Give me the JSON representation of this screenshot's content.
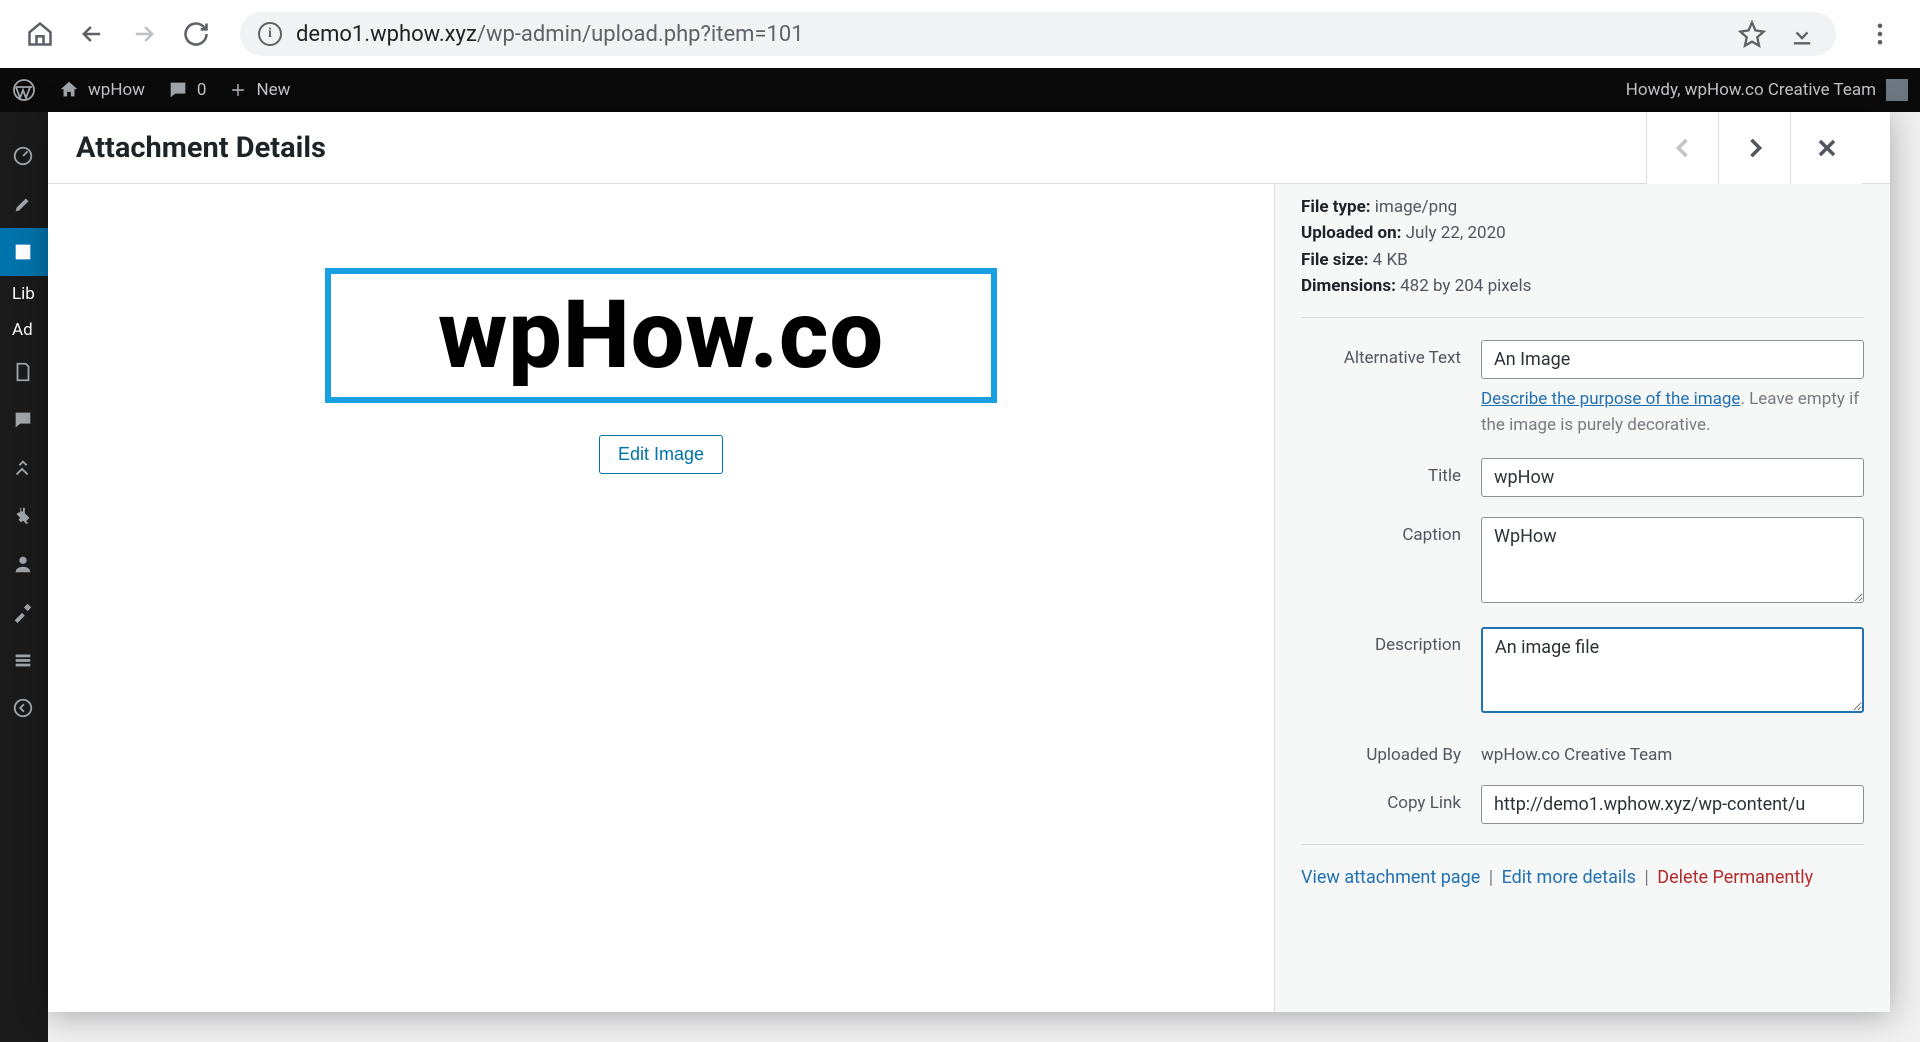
{
  "browser": {
    "url_domain": "demo1.wphow.xyz",
    "url_path": "/wp-admin/upload.php?item=101"
  },
  "adminbar": {
    "site_name": "wpHow",
    "comment_count": "0",
    "new_label": "New",
    "howdy": "Howdy, wpHow.co Creative Team"
  },
  "sidebar": {
    "lib_label": "Lib",
    "add_label": "Ad"
  },
  "modal": {
    "title": "Attachment Details",
    "meta": {
      "file_type_label": "File type:",
      "file_type_value": "image/png",
      "uploaded_on_label": "Uploaded on:",
      "uploaded_on_value": "July 22, 2020",
      "file_size_label": "File size:",
      "file_size_value": "4 KB",
      "dimensions_label": "Dimensions:",
      "dimensions_value": "482 by 204 pixels"
    },
    "preview_text": "wpHow.co",
    "edit_image_label": "Edit Image",
    "fields": {
      "alt_label": "Alternative Text",
      "alt_value": "An Image",
      "alt_help_link": "Describe the purpose of the image",
      "alt_help_rest": ". Leave empty if the image is purely decorative.",
      "title_label": "Title",
      "title_value": "wpHow",
      "caption_label": "Caption",
      "caption_value": "WpHow",
      "description_label": "Description",
      "description_value": "An image file",
      "uploaded_by_label": "Uploaded By",
      "uploaded_by_value": "wpHow.co Creative Team",
      "copy_link_label": "Copy Link",
      "copy_link_value": "http://demo1.wphow.xyz/wp-content/u"
    },
    "actions": {
      "view": "View attachment page",
      "edit": "Edit more details",
      "delete": "Delete Permanently"
    }
  }
}
